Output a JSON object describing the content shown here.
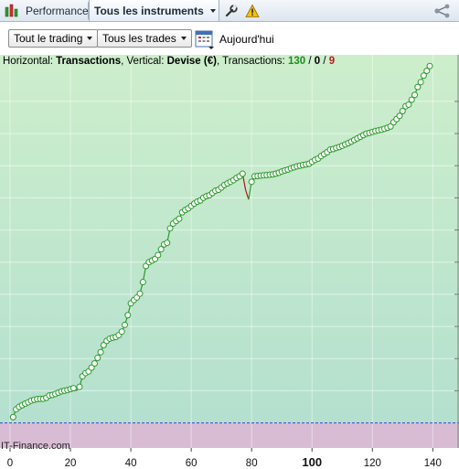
{
  "topbar": {
    "performance_label": "Performance",
    "instruments_label": "Tous les instruments",
    "icons": [
      "chart-icon",
      "dropdown-caret-icon",
      "wrench-icon",
      "warning-icon",
      "share-icon"
    ]
  },
  "toolbar": {
    "trading_dropdown": "Tout le trading",
    "trades_dropdown": "Tous les trades",
    "date_label": "Aujourd'hui"
  },
  "chart_header": {
    "horizontal_prefix": "Horizontal: ",
    "horizontal_value": "Transactions",
    "vertical_prefix": ", Vertical: ",
    "vertical_value": "Devise (€)",
    "transactions_prefix": ", Transactions: ",
    "count_green": "130",
    "sep1": " / ",
    "count_black": "0",
    "sep2": " / ",
    "count_red": "9"
  },
  "watermark": "IT-Finance.com",
  "colors": {
    "positive_area": "#c9edc9",
    "negative_area": "#d8bcd4",
    "line_up": "#2a9a2a",
    "line_down": "#b01515",
    "marker_fill": "#ffffff",
    "marker_stroke": "#2a9a2a",
    "zero_line": "#3a46c8"
  },
  "chart_data": {
    "type": "line",
    "xlabel": "Transactions",
    "ylabel": "Devise (€)",
    "xlim": [
      0,
      143
    ],
    "x_ticks": [
      {
        "v": 0,
        "label": "0",
        "bold": false
      },
      {
        "v": 20,
        "label": "20",
        "bold": false
      },
      {
        "v": 40,
        "label": "40",
        "bold": false
      },
      {
        "v": 60,
        "label": "60",
        "bold": false
      },
      {
        "v": 80,
        "label": "80",
        "bold": false
      },
      {
        "v": 100,
        "label": "100",
        "bold": true
      },
      {
        "v": 120,
        "label": "120",
        "bold": false
      },
      {
        "v": 140,
        "label": "140",
        "bold": false
      }
    ],
    "ylim": [
      -0.78,
      11.05
    ],
    "y_gridlines": [
      0,
      1,
      2,
      3,
      4,
      5,
      6,
      7,
      8,
      9,
      10
    ],
    "zero_level": 0,
    "series": [
      {
        "x": [
          1,
          2,
          3,
          4,
          5,
          6,
          7,
          8,
          9,
          10,
          11,
          12,
          13,
          14,
          15,
          16,
          17,
          18,
          19,
          20,
          21,
          22,
          23,
          24,
          25,
          26,
          27,
          28,
          29,
          30,
          31,
          32,
          33,
          34,
          35,
          36,
          37,
          38,
          39,
          40,
          41,
          42,
          43,
          44,
          45,
          46,
          47,
          48,
          49,
          50,
          51,
          52,
          53,
          54,
          55,
          56,
          57,
          58,
          59,
          60,
          61,
          62,
          63,
          64,
          65,
          66,
          67,
          68,
          69,
          70,
          71,
          72,
          73,
          74,
          75,
          76,
          77,
          78,
          79,
          80,
          81,
          82,
          83,
          84,
          85,
          86,
          87,
          88,
          89,
          90,
          91,
          92,
          93,
          94,
          95,
          96,
          97,
          98,
          99,
          100,
          101,
          102,
          103,
          104,
          105,
          106,
          107,
          108,
          109,
          110,
          111,
          112,
          113,
          114,
          115,
          116,
          117,
          118,
          119,
          120,
          121,
          122,
          123,
          124,
          125,
          126,
          127,
          128,
          129,
          130,
          131,
          132,
          133,
          134,
          135,
          136,
          137,
          138,
          139
        ],
        "values": [
          0.18,
          0.42,
          0.5,
          0.55,
          0.6,
          0.64,
          0.69,
          0.72,
          0.74,
          0.75,
          0.75,
          0.78,
          0.85,
          0.87,
          0.9,
          0.94,
          0.98,
          1.0,
          1.02,
          1.05,
          1.08,
          1.0,
          1.12,
          1.45,
          1.55,
          1.6,
          1.72,
          1.85,
          2.02,
          2.2,
          2.42,
          2.55,
          2.62,
          2.65,
          2.67,
          2.73,
          2.84,
          3.05,
          3.35,
          3.72,
          3.82,
          3.9,
          4.02,
          4.38,
          4.88,
          5.0,
          5.05,
          5.1,
          5.22,
          5.4,
          5.55,
          5.6,
          6.05,
          6.2,
          6.28,
          6.35,
          6.55,
          6.62,
          6.67,
          6.75,
          6.82,
          6.88,
          6.92,
          7.0,
          7.05,
          7.08,
          7.15,
          7.22,
          7.25,
          7.32,
          7.4,
          7.45,
          7.5,
          7.55,
          7.62,
          7.67,
          7.75,
          7.25,
          6.95,
          7.5,
          7.67,
          7.68,
          7.69,
          7.7,
          7.71,
          7.72,
          7.73,
          7.75,
          7.78,
          7.82,
          7.85,
          7.88,
          7.92,
          7.95,
          7.98,
          8.0,
          8.02,
          8.04,
          8.06,
          8.12,
          8.18,
          8.22,
          8.3,
          8.36,
          8.42,
          8.5,
          8.52,
          8.55,
          8.58,
          8.62,
          8.66,
          8.7,
          8.75,
          8.8,
          8.85,
          8.9,
          8.95,
          9.0,
          9.02,
          9.05,
          9.08,
          9.1,
          9.12,
          9.15,
          9.18,
          9.22,
          9.35,
          9.45,
          9.55,
          9.7,
          9.85,
          9.9,
          10.05,
          10.2,
          10.45,
          10.6,
          10.8,
          10.95,
          11.1
        ],
        "markers": true
      }
    ]
  }
}
